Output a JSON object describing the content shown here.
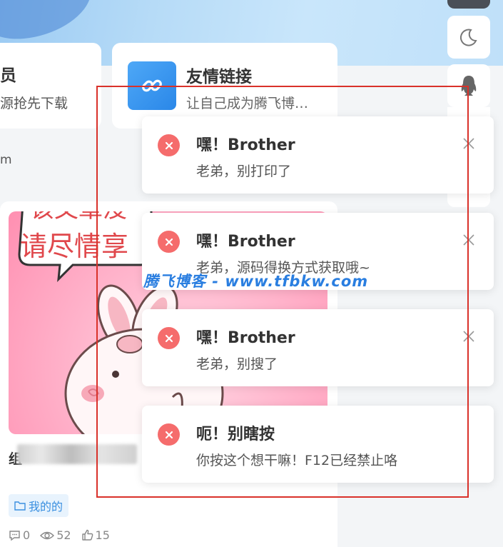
{
  "vip_card": {
    "title": "员",
    "desc": "源抢先下载"
  },
  "link_card": {
    "title": "友情链接",
    "desc": "让自己成为腾飞博…"
  },
  "small_text": "m",
  "post": {
    "image_text": "请尽情享",
    "image_text_top": "该文章没",
    "title_prefix": "组",
    "title_suffix": "观",
    "tag": "我的的",
    "stats": {
      "comments": "0",
      "views": "52",
      "likes": "15"
    }
  },
  "toasts": [
    {
      "title": "嘿！Brother",
      "message": "老弟，别打印了",
      "closable": true
    },
    {
      "title": "嘿！Brother",
      "message": "老弟，源码得换方式获取哦~",
      "closable": true
    },
    {
      "title": "嘿！Brother",
      "message": "老弟，别搜了",
      "closable": true
    },
    {
      "title": "呃！别瞎按",
      "message": "你按这个想干嘛！F12已经禁止咯",
      "closable": false
    }
  ],
  "watermark": "腾飞博客 - www.tfbkw.com",
  "colors": {
    "error": "#f56c6c",
    "accent": "#3a8fe0",
    "frame": "#d9312a"
  },
  "icons": [
    "moon-icon",
    "qq-penguin-icon",
    "link-chain-icon",
    "folder-icon",
    "comment-icon",
    "eye-icon",
    "thumb-up-icon",
    "close-icon",
    "error-circle-icon"
  ]
}
